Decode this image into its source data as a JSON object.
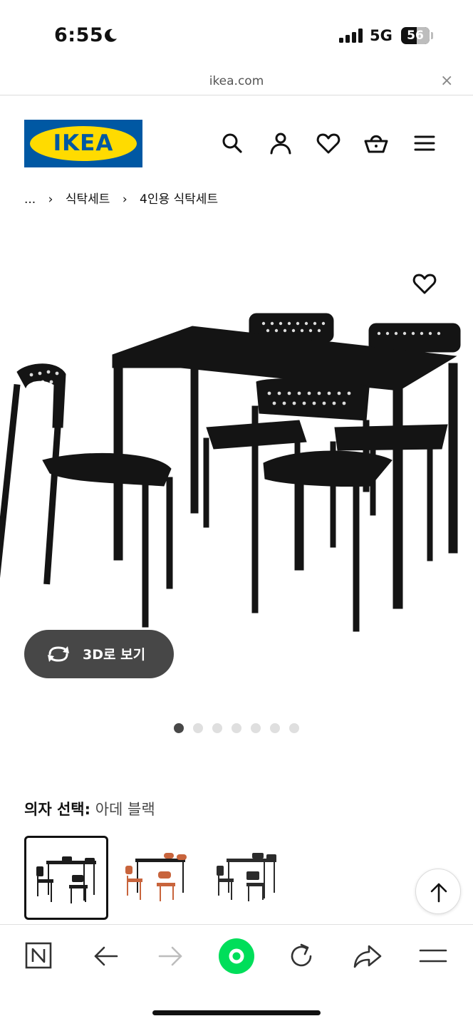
{
  "status_bar": {
    "time": "6:55",
    "network": "5G",
    "battery": "56",
    "battery_level": 0.56
  },
  "browser": {
    "url": "ikea.com",
    "close_symbol": "×"
  },
  "header": {
    "logo_text": "IKEA",
    "icons": [
      "search-icon",
      "account-icon",
      "heart-icon",
      "shopping-basket-icon",
      "menu-icon"
    ]
  },
  "breadcrumb": {
    "items": [
      "...",
      "식탁세트",
      "4인용 식탁세트"
    ],
    "separator": "›"
  },
  "product": {
    "image": "dining-table-with-four-chairs",
    "view_3d_label": "3D로 보기",
    "carousel": {
      "count": 7,
      "active_index": 0
    },
    "chair_select": {
      "label": "의자 선택:",
      "value": "아데 블랙"
    },
    "variants": [
      {
        "name": "black-table-black-chairs",
        "selected": true,
        "chair_color": "#1c1c1c"
      },
      {
        "name": "black-table-orange-chairs",
        "selected": false,
        "chair_color": "#c8643c"
      },
      {
        "name": "black-table-black-chairs-alt",
        "selected": false,
        "chair_color": "#2b2b2b"
      }
    ]
  },
  "toolbar": {
    "icons": [
      "naver-icon",
      "back-arrow-icon",
      "forward-arrow-icon",
      "green-dot-icon",
      "reload-icon",
      "share-icon",
      "menu-icon"
    ],
    "accent": "#00de5a"
  },
  "colors": {
    "ikea_blue": "#0058a3",
    "ikea_yellow": "#ffdb00",
    "pill_bg": "#474747"
  }
}
